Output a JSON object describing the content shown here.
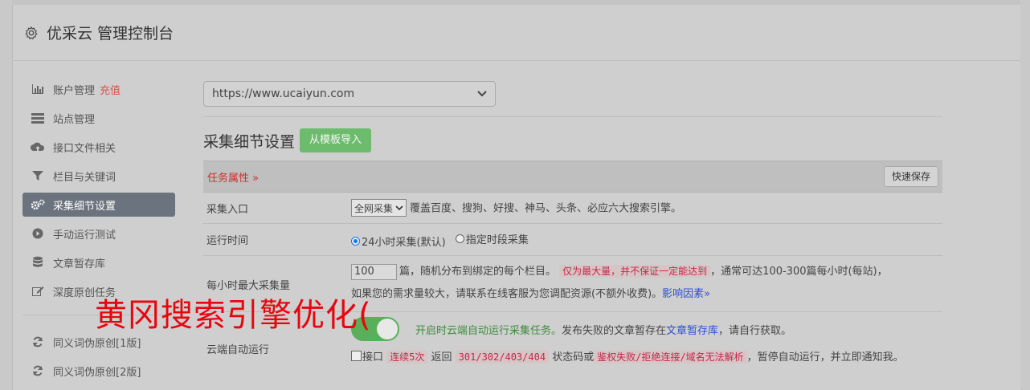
{
  "header": {
    "title": "优采云 管理控制台",
    "icon": "gear-icon"
  },
  "sidebar": {
    "items": [
      {
        "label": "账户管理",
        "badge": "充值",
        "icon": "bar-chart-icon"
      },
      {
        "label": "站点管理",
        "icon": "server-icon"
      },
      {
        "label": "接口文件相关",
        "icon": "cloud-upload-icon"
      },
      {
        "label": "栏目与关键词",
        "icon": "filter-icon"
      },
      {
        "label": "采集细节设置",
        "icon": "gears-icon",
        "active": true
      },
      {
        "label": "手动运行测试",
        "icon": "play-circle-icon"
      },
      {
        "label": "文章暂存库",
        "icon": "database-icon"
      },
      {
        "label": "深度原创任务",
        "icon": "edit-icon"
      },
      {
        "label": "同义词伪原创[1版]",
        "icon": "refresh-icon"
      },
      {
        "label": "同义词伪原创[2版]",
        "icon": "refresh-icon"
      }
    ]
  },
  "site_select": {
    "value": "https://www.ucaiyun.com"
  },
  "section": {
    "title": "采集细节设置",
    "import_button": "从模板导入"
  },
  "task_bar": {
    "label": "任务属性 »",
    "save_button": "快速保存"
  },
  "rows": {
    "entry": {
      "label": "采集入口",
      "select_value": "全网采集",
      "desc": "覆盖百度、搜狗、好搜、神马、头条、必应六大搜索引擎。"
    },
    "runtime": {
      "label": "运行时间",
      "opt1": "24小时采集(默认)",
      "opt2": "指定时段采集"
    },
    "max_per_hour": {
      "label": "每小时最大采集量",
      "value": "100",
      "text1": "篇，随机分布到绑定的每个栏目。",
      "note": "仅为最大量，并不保证一定能达到",
      "text2": "，通常可达100-300篇每小时(每站)，",
      "text3": "如果您的需求量较大，请联系在线客服为您调配资源(不额外收费)。",
      "link": "影响因素"
    },
    "cloud": {
      "label": "云端自动运行",
      "green_text": "开启时云端自动运行采集任务。",
      "text1": "发布失败的文章暂存在",
      "link": "文章暂存库",
      "text2": "，请自行获取。",
      "chk_label": "接口",
      "code1": "连续5次",
      "text3": "返回",
      "code2": "301/302/403/404",
      "text4": "状态码或",
      "code3": "鉴权失败/拒绝连接/域名无法解析",
      "text5": "，暂停自动运行，并立即通知我。"
    }
  },
  "overlay_text": "黄冈搜索引擎优化("
}
